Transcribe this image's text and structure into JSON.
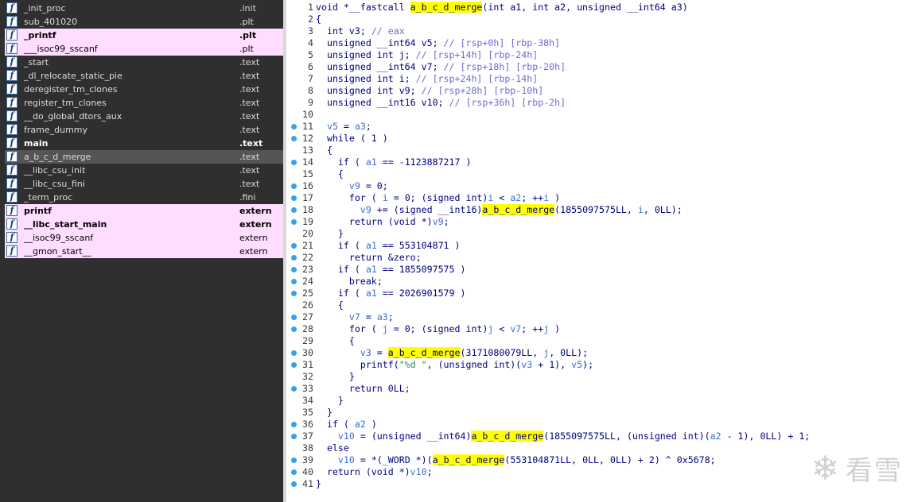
{
  "functions": [
    {
      "name": "_init_proc",
      "segment": ".init",
      "style": ""
    },
    {
      "name": "sub_401020",
      "segment": ".plt",
      "style": ""
    },
    {
      "name": "_printf",
      "segment": ".plt",
      "style": "hl"
    },
    {
      "name": "___isoc99_sscanf",
      "segment": ".plt",
      "style": "ext"
    },
    {
      "name": "_start",
      "segment": ".text",
      "style": ""
    },
    {
      "name": "_dl_relocate_static_pie",
      "segment": ".text",
      "style": ""
    },
    {
      "name": "deregister_tm_clones",
      "segment": ".text",
      "style": ""
    },
    {
      "name": "register_tm_clones",
      "segment": ".text",
      "style": ""
    },
    {
      "name": "__do_global_dtors_aux",
      "segment": ".text",
      "style": ""
    },
    {
      "name": "frame_dummy",
      "segment": ".text",
      "style": ""
    },
    {
      "name": "main",
      "segment": ".text",
      "style": "bold"
    },
    {
      "name": "a_b_c_d_merge",
      "segment": ".text",
      "style": "sel"
    },
    {
      "name": "__libc_csu_init",
      "segment": ".text",
      "style": ""
    },
    {
      "name": "__libc_csu_fini",
      "segment": ".text",
      "style": ""
    },
    {
      "name": "_term_proc",
      "segment": ".fini",
      "style": ""
    },
    {
      "name": "printf",
      "segment": "extern",
      "style": "hl"
    },
    {
      "name": "__libc_start_main",
      "segment": "extern",
      "style": "hl"
    },
    {
      "name": "__isoc99_sscanf",
      "segment": "extern",
      "style": "ext"
    },
    {
      "name": "__gmon_start__",
      "segment": "extern",
      "style": "ext"
    }
  ],
  "code_lines": [
    {
      "n": "1",
      "dot": false,
      "html": "void *__fastcall <span class=\"h\">a_b_c_d_merge</span>(int a1, int a2, unsigned __int64 a3)"
    },
    {
      "n": "2",
      "dot": false,
      "html": "{"
    },
    {
      "n": "3",
      "dot": false,
      "html": "  int v3; <span class=\"g\">// eax</span>"
    },
    {
      "n": "4",
      "dot": false,
      "html": "  unsigned __int64 v5; <span class=\"g\">// [rsp+0h] [rbp-38h]</span>"
    },
    {
      "n": "5",
      "dot": false,
      "html": "  unsigned int j; <span class=\"g\">// [rsp+14h] [rbp-24h]</span>"
    },
    {
      "n": "6",
      "dot": false,
      "html": "  unsigned __int64 v7; <span class=\"g\">// [rsp+18h] [rbp-20h]</span>"
    },
    {
      "n": "7",
      "dot": false,
      "html": "  unsigned int i; <span class=\"g\">// [rsp+24h] [rbp-14h]</span>"
    },
    {
      "n": "8",
      "dot": false,
      "html": "  unsigned int v9; <span class=\"g\">// [rsp+28h] [rbp-10h]</span>"
    },
    {
      "n": "9",
      "dot": false,
      "html": "  unsigned __int16 v10; <span class=\"g\">// [rsp+36h] [rbp-2h]</span>"
    },
    {
      "n": "10",
      "dot": false,
      "html": ""
    },
    {
      "n": "11",
      "dot": true,
      "html": "  <span class=\"v\">v5</span> = <span class=\"v\">a3</span>;"
    },
    {
      "n": "12",
      "dot": true,
      "html": "  while ( 1 )"
    },
    {
      "n": "13",
      "dot": false,
      "html": "  {"
    },
    {
      "n": "14",
      "dot": true,
      "html": "    if ( <span class=\"v\">a1</span> == -1123887217 )"
    },
    {
      "n": "15",
      "dot": false,
      "html": "    {"
    },
    {
      "n": "16",
      "dot": true,
      "html": "      <span class=\"v\">v9</span> = 0;"
    },
    {
      "n": "17",
      "dot": true,
      "html": "      for ( <span class=\"v\">i</span> = 0; (signed int)<span class=\"v\">i</span> &lt; <span class=\"v\">a2</span>; ++<span class=\"v\">i</span> )"
    },
    {
      "n": "18",
      "dot": true,
      "html": "        <span class=\"v\">v9</span> += (signed __int16)<span class=\"h\">a_b_c_d_merge</span>(1855097575LL, <span class=\"v\">i</span>, 0LL);"
    },
    {
      "n": "19",
      "dot": true,
      "html": "      return (void *)<span class=\"v\">v9</span>;"
    },
    {
      "n": "20",
      "dot": false,
      "html": "    }"
    },
    {
      "n": "21",
      "dot": true,
      "html": "    if ( <span class=\"v\">a1</span> == 553104871 )"
    },
    {
      "n": "22",
      "dot": true,
      "html": "      return &amp;zero;"
    },
    {
      "n": "23",
      "dot": true,
      "html": "    if ( <span class=\"v\">a1</span> == 1855097575 )"
    },
    {
      "n": "24",
      "dot": true,
      "html": "      break;"
    },
    {
      "n": "25",
      "dot": true,
      "html": "    if ( <span class=\"v\">a1</span> == 2026901579 )"
    },
    {
      "n": "26",
      "dot": false,
      "html": "    {"
    },
    {
      "n": "27",
      "dot": true,
      "html": "      <span class=\"v\">v7</span> = <span class=\"v\">a3</span>;"
    },
    {
      "n": "28",
      "dot": true,
      "html": "      for ( <span class=\"v\">j</span> = 0; (signed int)<span class=\"v\">j</span> &lt; <span class=\"v\">v7</span>; ++<span class=\"v\">j</span> )"
    },
    {
      "n": "29",
      "dot": false,
      "html": "      {"
    },
    {
      "n": "30",
      "dot": true,
      "html": "        <span class=\"v\">v3</span> = <span class=\"h\">a_b_c_d_merge</span>(3171080079LL, <span class=\"v\">j</span>, 0LL);"
    },
    {
      "n": "31",
      "dot": true,
      "html": "        printf(<span class=\"s\">\"%d \"</span>, (unsigned int)(<span class=\"v\">v3</span> + 1), <span class=\"v\">v5</span>);"
    },
    {
      "n": "32",
      "dot": false,
      "html": "      }"
    },
    {
      "n": "33",
      "dot": true,
      "html": "      return 0LL;"
    },
    {
      "n": "34",
      "dot": false,
      "html": "    }"
    },
    {
      "n": "35",
      "dot": false,
      "html": "  }"
    },
    {
      "n": "36",
      "dot": true,
      "html": "  if ( <span class=\"v\">a2</span> )"
    },
    {
      "n": "37",
      "dot": true,
      "html": "    <span class=\"v\">v10</span> = (unsigned __int64)<span class=\"h\">a_b_c_d_merge</span>(1855097575LL, (unsigned int)(<span class=\"v\">a2</span> - 1), 0LL) + 1;"
    },
    {
      "n": "38",
      "dot": false,
      "html": "  else"
    },
    {
      "n": "39",
      "dot": true,
      "html": "    <span class=\"v\">v10</span> = *(_WORD *)(<span class=\"h\">a_b_c_d_merge</span>(553104871LL, 0LL, 0LL) + 2) ^ 0x5678;"
    },
    {
      "n": "40",
      "dot": true,
      "html": "  return (void *)<span class=\"v\">v10</span>;"
    },
    {
      "n": "41",
      "dot": true,
      "html": "}"
    }
  ],
  "function_icon_glyph": "f",
  "watermark": {
    "icon": "snowflake-icon",
    "text": "看雪"
  },
  "colors": {
    "highlight": "#ffff00",
    "pink_row": "#ffddff",
    "code_text": "#000080",
    "comment": "#6b6bd6",
    "dot": "#3aa0e8"
  }
}
